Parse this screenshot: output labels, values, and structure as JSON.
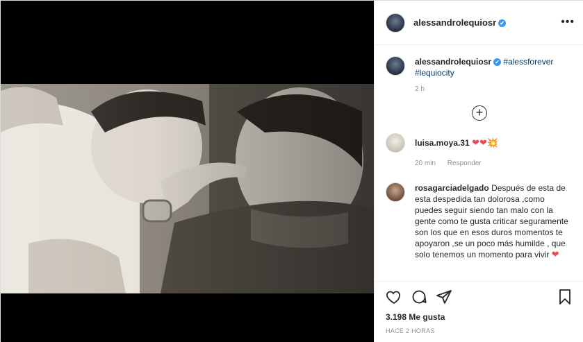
{
  "post": {
    "username": "alessandrolequiosr",
    "verified_symbol": "✔",
    "more_symbol": "•••",
    "caption_hashtags": "#alessforever #lequiocity",
    "caption_time": "2 h"
  },
  "comments": [
    {
      "username": "luisa.moya.31",
      "text": "",
      "emoji": "❤❤💥",
      "time": "20 min",
      "reply_label": "Responder"
    },
    {
      "username": "rosagarciadelgado",
      "text": "Después de esta de esta despedida tan dolorosa ,como puedes seguir siendo tan malo con la gente como te gusta criticar seguramente son los que en esos duros momentos te apoyaron ,se un poco más humilde , que solo tenemos un momento para vivir"
    }
  ],
  "load_more_symbol": "+",
  "stats": {
    "likes": "3.198 Me gusta",
    "posted": "HACE 2 HORAS"
  }
}
